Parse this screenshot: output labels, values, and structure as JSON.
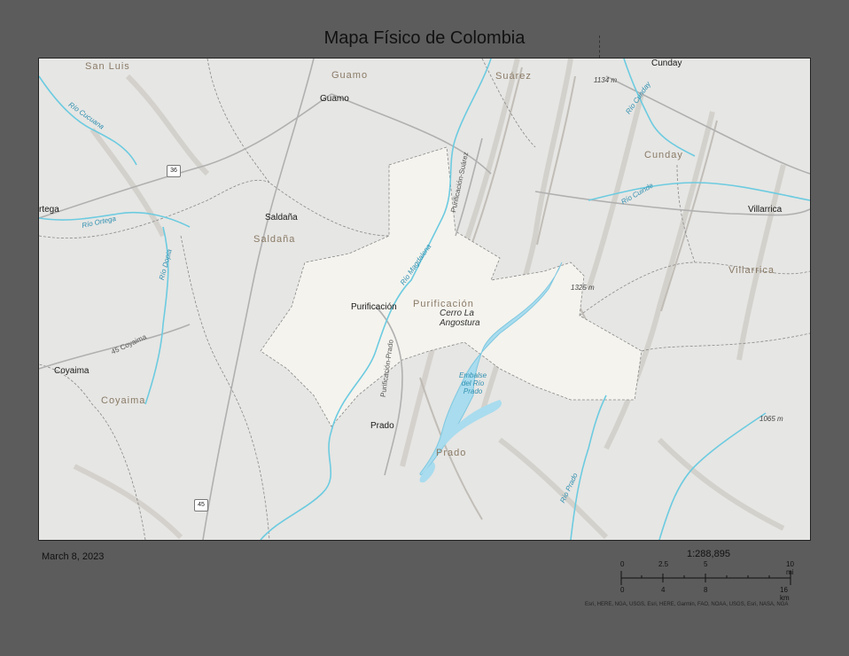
{
  "title": "Mapa Físico de Colombia",
  "date": "March 8, 2023",
  "scale": {
    "ratio": "1:288,895",
    "mi_ticks": [
      "0",
      "2.5",
      "5",
      "10 mi"
    ],
    "km_ticks": [
      "0",
      "4",
      "8",
      "16 km"
    ]
  },
  "attribution": "Esri, HERE, NGA, USGS, Esri, HERE, Garmin, FAO, NOAA, USGS, Esri, NASA, NGA",
  "map": {
    "towns": {
      "guamo": "Guamo",
      "saldana": "Saldaña",
      "purificacion": "Purificación",
      "coyaima": "Coyaima",
      "prado": "Prado",
      "cunday": "Cunday",
      "villarrica": "Villarrica",
      "ortega": "rtega"
    },
    "regions": {
      "san_luis": "San Luis",
      "guamo": "Guamo",
      "suarez": "Suárez",
      "saldana": "Saldaña",
      "purificacion": "Purificación",
      "coyaima": "Coyaima",
      "prado": "Prado",
      "cunday": "Cunday",
      "villarrica": "Villarrica"
    },
    "features": {
      "cerro": "Cerro La\nAngostura",
      "embalse": "Embalse\ndel Río\nPrado"
    },
    "elevations": [
      "1134 m",
      "1325 m",
      "1065 m"
    ],
    "rivers": {
      "cucuana": "Río Cucuana",
      "ortega": "Río Ortega",
      "dopia": "Río Dopia",
      "magdalena": "Río Magdalena",
      "cunday": "Río Cunday",
      "cuinde": "Río Cuinde",
      "prado": "Río Prado"
    },
    "roads": {
      "purificacion_suarez": "Purificación-Suárez",
      "purificacion_prado": "Purificación-Prado",
      "coyaima_45": "45 Coyaima"
    },
    "shields": [
      "36",
      "45"
    ]
  },
  "colors": {
    "background": "#5c5c5c",
    "map_base": "#e6e6e4",
    "highlight": "#f4f3ee",
    "water": "#a9dcee",
    "river": "#6ccbe0"
  }
}
